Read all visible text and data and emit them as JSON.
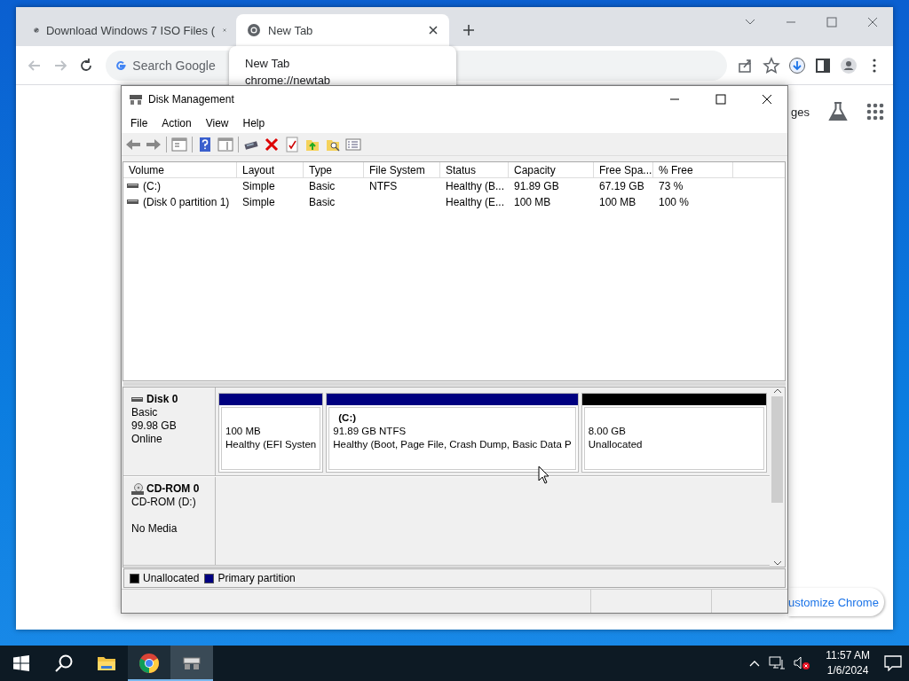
{
  "browser": {
    "tabs": [
      {
        "title": "Download Windows 7 ISO Files (",
        "selected": false
      },
      {
        "title": "New Tab",
        "selected": true
      }
    ],
    "address": {
      "placeholder": "Search Google"
    },
    "tooltip": {
      "title": "New Tab",
      "url": "chrome://newtab"
    },
    "page": {
      "link_text": "ges",
      "customize_button": "ustomize Chrome"
    }
  },
  "disk_management": {
    "title": "Disk Management",
    "menu": [
      "File",
      "Action",
      "View",
      "Help"
    ],
    "columns": [
      "Volume",
      "Layout",
      "Type",
      "File System",
      "Status",
      "Capacity",
      "Free Spa...",
      "% Free"
    ],
    "rows": [
      {
        "cells": [
          "(C:)",
          "Simple",
          "Basic",
          "NTFS",
          "Healthy (B...",
          "91.89 GB",
          "67.19 GB",
          "73 %"
        ],
        "selected": false
      },
      {
        "cells": [
          "(Disk 0 partition 1)",
          "Simple",
          "Basic",
          "",
          "Healthy (E...",
          "100 MB",
          "100 MB",
          "100 %"
        ],
        "selected": false
      }
    ],
    "disks": [
      {
        "kind": "disk",
        "name": "Disk 0",
        "info": [
          "Basic",
          "99.98 GB",
          "Online"
        ],
        "partitions": [
          {
            "color": "#000080",
            "lines": [
              "100 MB",
              "Healthy (EFI Systen"
            ]
          },
          {
            "color": "#000080",
            "name": "(C:)",
            "lines": [
              "91.89 GB NTFS",
              "Healthy (Boot, Page File, Crash Dump, Basic Data P"
            ]
          },
          {
            "color": "#000000",
            "lines": [
              "8.00 GB",
              "Unallocated"
            ]
          }
        ]
      },
      {
        "kind": "cdrom",
        "name": "CD-ROM 0",
        "info": [
          "CD-ROM (D:)",
          "No Media"
        ]
      }
    ],
    "legend": [
      {
        "label": "Unallocated",
        "color": "#000000"
      },
      {
        "label": "Primary partition",
        "color": "#000080"
      }
    ]
  },
  "taskbar": {
    "apps": [
      {
        "kind": "explorer",
        "running": false,
        "selected": false
      },
      {
        "kind": "chrome",
        "running": true,
        "selected": false
      },
      {
        "kind": "diskmgmt",
        "running": true,
        "selected": true
      }
    ],
    "time": "11:57 AM",
    "date": "1/6/2024"
  }
}
